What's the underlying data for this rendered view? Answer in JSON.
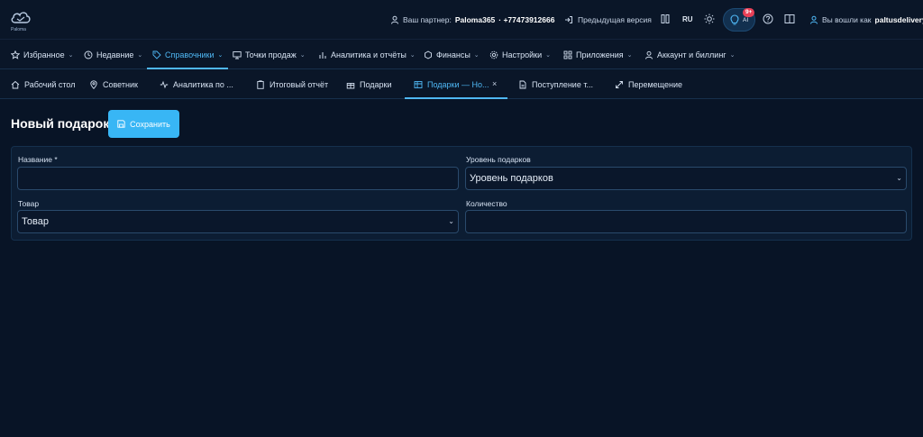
{
  "app": {
    "logo_text": "Paloma",
    "partner_label": "Ваш партнер:",
    "partner_name": "Paloma365",
    "partner_phone": "· +77473912666",
    "prev_version": "Предыдущая версия",
    "lang": "RU",
    "ai_label": "AI",
    "ai_badge": "9+",
    "user_label": "Вы вошли как",
    "user_name": "paltusdelivery"
  },
  "menu": [
    {
      "label": "Избранное",
      "icon": "star-icon"
    },
    {
      "label": "Недавние",
      "icon": "clock-icon"
    },
    {
      "label": "Справочники",
      "icon": "tag-icon",
      "active": true
    },
    {
      "label": "Точки продаж",
      "icon": "monitor-icon"
    },
    {
      "label": "Аналитика и отчёты",
      "icon": "bar-chart-icon"
    },
    {
      "label": "Финансы",
      "icon": "coin-icon"
    },
    {
      "label": "Настройки",
      "icon": "gear-icon"
    },
    {
      "label": "Приложения",
      "icon": "grid-icon"
    },
    {
      "label": "Аккаунт и биллинг",
      "icon": "user-icon"
    }
  ],
  "tabs": [
    {
      "label": "Рабочий стол",
      "icon": "home-icon"
    },
    {
      "label": "Советник",
      "icon": "map-pin-icon"
    },
    {
      "label": "Аналитика по ...",
      "icon": "activity-icon"
    },
    {
      "label": "Итоговый отчёт",
      "icon": "clipboard-icon"
    },
    {
      "label": "Подарки",
      "icon": "gift-icon"
    },
    {
      "label": "Подарки — Но...",
      "icon": "table-icon",
      "active": true
    },
    {
      "label": "Поступление т...",
      "icon": "file-icon"
    },
    {
      "label": "Перемещение",
      "icon": "move-icon"
    }
  ],
  "tab_close": "×",
  "page": {
    "title": "Новый подарок",
    "save_label": "Сохранить"
  },
  "form": {
    "name_label": "Название *",
    "name_value": "",
    "level_label": "Уровень подарков",
    "level_value": "Уровень подарков",
    "product_label": "Товар",
    "product_value": "Товар",
    "qty_label": "Количество",
    "qty_value": ""
  },
  "colors": {
    "background": "#081426",
    "accent": "#38b6f5",
    "active_text": "#4fb8f5",
    "badge": "#e84057"
  }
}
